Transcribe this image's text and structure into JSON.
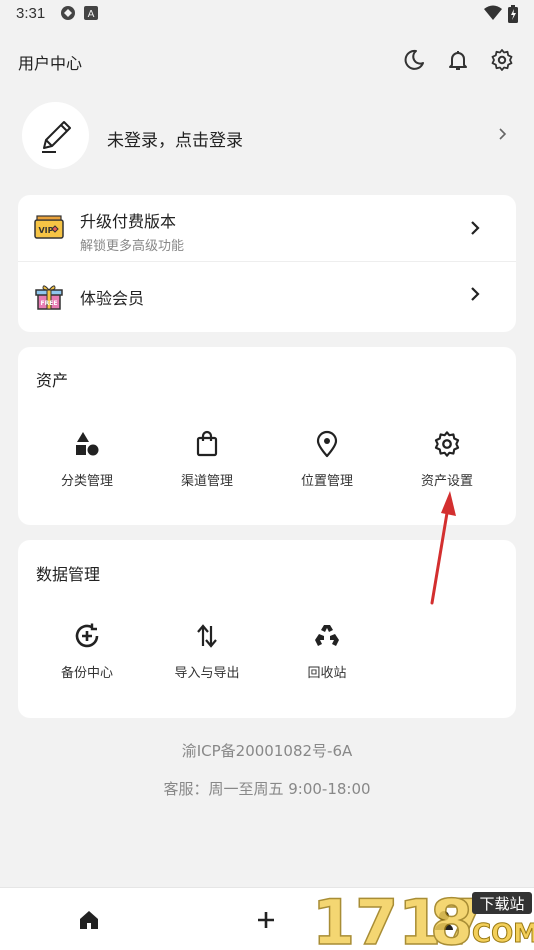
{
  "status": {
    "time": "3:31"
  },
  "header": {
    "title": "用户中心",
    "icons": [
      "moon-icon",
      "bell-icon",
      "gear-icon"
    ]
  },
  "profile": {
    "login_text": "未登录，点击登录"
  },
  "vip": {
    "upgrade_title": "升级付费版本",
    "upgrade_sub": "解锁更多高级功能",
    "trial_title": "体验会员"
  },
  "assets": {
    "title": "资产",
    "items": [
      {
        "label": "分类管理",
        "icon": "shapes-icon"
      },
      {
        "label": "渠道管理",
        "icon": "shopping-bag-icon"
      },
      {
        "label": "位置管理",
        "icon": "location-pin-icon"
      },
      {
        "label": "资产设置",
        "icon": "gear-icon"
      }
    ]
  },
  "data_mgmt": {
    "title": "数据管理",
    "items": [
      {
        "label": "备份中心",
        "icon": "backup-icon"
      },
      {
        "label": "导入与导出",
        "icon": "import-export-icon"
      },
      {
        "label": "回收站",
        "icon": "recycle-icon"
      }
    ]
  },
  "footer": {
    "icp": "渝ICP备20001082号-6A",
    "service": "客服：周一至周五 9:00-18:00"
  },
  "watermark": {
    "text": "下载站"
  },
  "colors": {
    "accent": "#d32f2f",
    "background": "#f2f2f2",
    "card": "#ffffff"
  }
}
